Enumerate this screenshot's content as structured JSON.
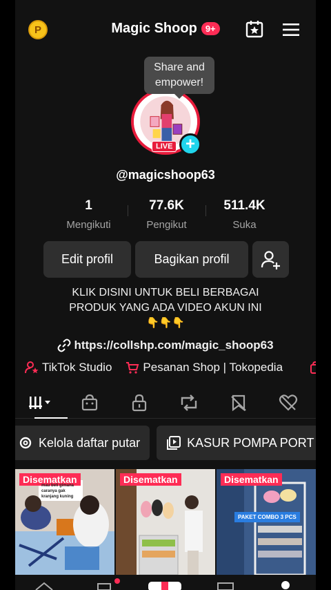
{
  "header": {
    "coin_letter": "P",
    "title": "Magic Shoop",
    "notif_badge": "9+"
  },
  "tooltip": {
    "line1": "Share and",
    "line2": "empower!"
  },
  "avatar": {
    "live_label": "LIVE",
    "plus": "+"
  },
  "profile": {
    "username": "@magicshoop63",
    "stats": [
      {
        "value": "1",
        "label": "Mengikuti"
      },
      {
        "value": "77.6K",
        "label": "Pengikut"
      },
      {
        "value": "511.4K",
        "label": "Suka"
      }
    ],
    "edit_label": "Edit profil",
    "share_label": "Bagikan profil",
    "bio_line1": "KLIK DISINI UNTUK BELI BERBAGAI",
    "bio_line2": "PRODUK YANG ADA VIDEO AKUN INI",
    "bio_emoji": "👇👇👇",
    "link": "https://collshp.com/magic_shoop63"
  },
  "tools": [
    {
      "label": "TikTok Studio",
      "icon": "person-star-icon"
    },
    {
      "label": "Pesanan Shop | Tokopedia",
      "icon": "cart-icon"
    }
  ],
  "tabs": [
    "grid-icon",
    "shop-bag-icon",
    "lock-icon",
    "repost-icon",
    "bookmark-icon",
    "heart-icon"
  ],
  "chips": [
    {
      "label": "Kelola daftar putar",
      "icon": "gear-icon"
    },
    {
      "label": "KASUR POMPA PORT",
      "icon": "playlist-icon"
    }
  ],
  "videos": [
    {
      "pinned": "Disematkan",
      "caption": "mau beli gimana caranya gak kranjang kuning"
    },
    {
      "pinned": "Disematkan",
      "caption": ""
    },
    {
      "pinned": "Disematkan",
      "caption": "PAKET COMBO 3 PCS"
    }
  ],
  "colors": {
    "accent": "#fe2c55",
    "teal": "#20d5ec",
    "bg": "#121212"
  }
}
